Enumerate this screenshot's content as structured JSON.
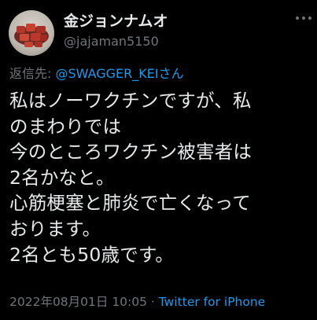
{
  "user": {
    "display_name": "金ジョンナムオ",
    "handle": "@jajaman5150",
    "avatar": "avatar-photo"
  },
  "more_icon": "more-horizontal-icon",
  "reply": {
    "prefix": "返信先: ",
    "mention": "@SWAGGER_KEIさん"
  },
  "body_lines": [
    "私はノーワクチンですが、私",
    "のまわりでは",
    "今のところワクチン被害者は",
    "2名かなと。",
    "心筋梗塞と肺炎で亡くなって",
    "おります。",
    "2名とも50歳です。"
  ],
  "meta": {
    "timestamp": "2022年08月01日 10:05",
    "separator": " · ",
    "source": "Twitter for iPhone"
  },
  "colors": {
    "background": "#000000",
    "text": "#e7e9ea",
    "secondary": "#71767b",
    "link": "#1d9bf0"
  }
}
